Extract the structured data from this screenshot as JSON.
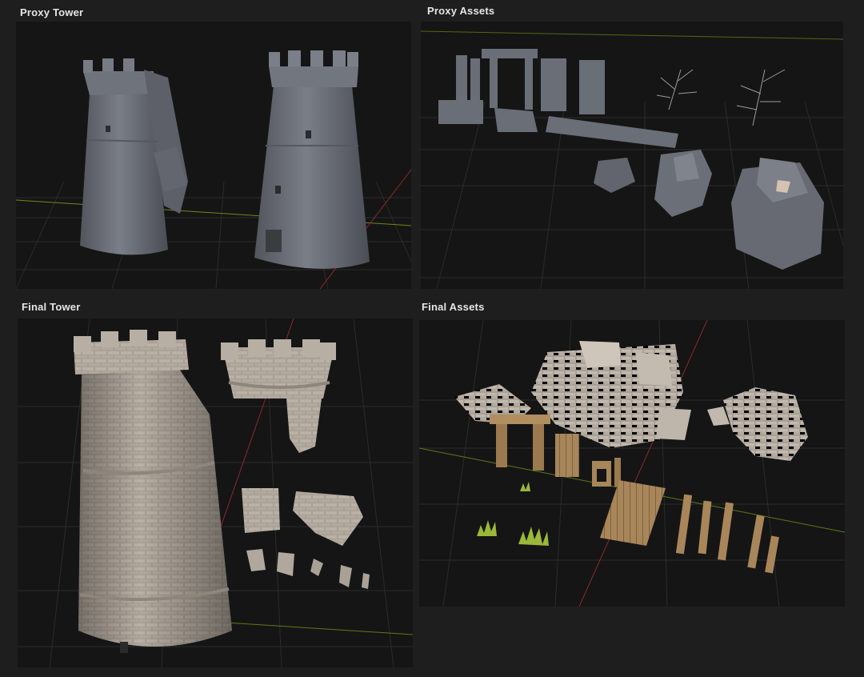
{
  "panels": {
    "proxy_tower": {
      "label": "Proxy Tower"
    },
    "proxy_assets": {
      "label": "Proxy Assets"
    },
    "final_tower": {
      "label": "Final Tower"
    },
    "final_assets": {
      "label": "Final Assets"
    }
  },
  "colors": {
    "background": "#1e1e1e",
    "viewport": "#151515",
    "grid": "#2d2d2d",
    "axis_x": "#b02a2a",
    "axis_y": "#6b8a1c",
    "proxy_grey": "#6d717a",
    "stone": "#b5aca2",
    "wood": "#a8865a",
    "grass": "#9bb83a"
  }
}
